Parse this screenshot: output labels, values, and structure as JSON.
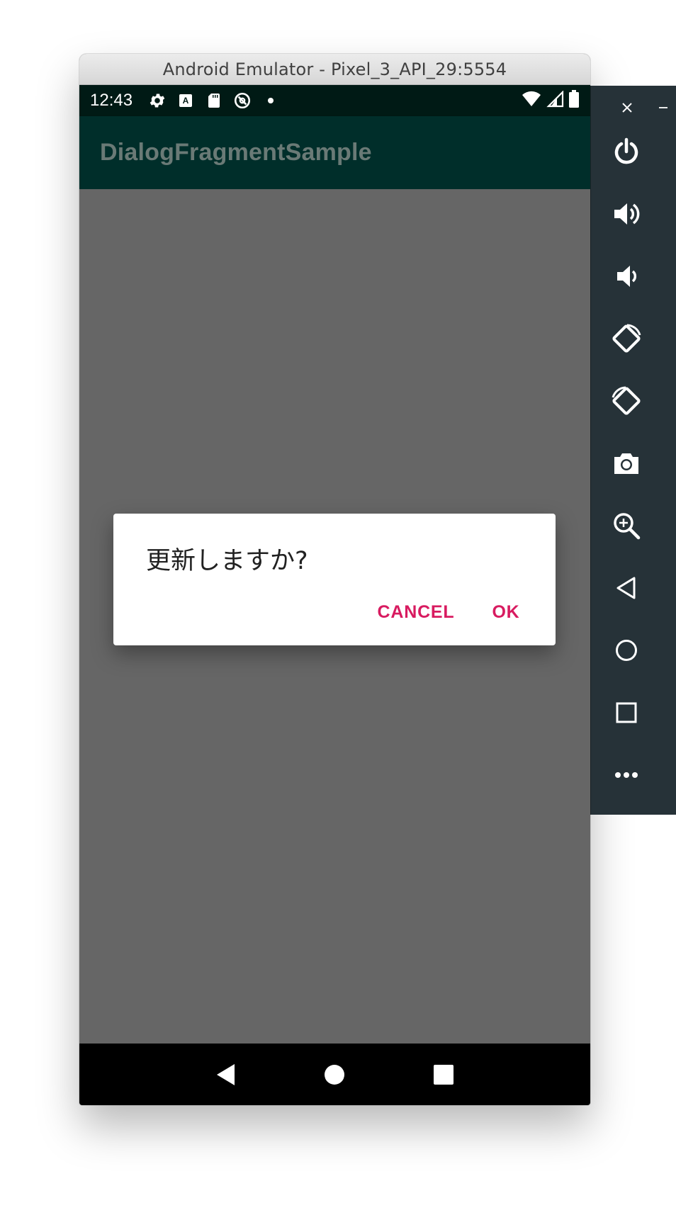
{
  "window": {
    "title": "Android Emulator - Pixel_3_API_29:5554"
  },
  "status_bar": {
    "time": "12:43",
    "icons_left": [
      "gear-icon",
      "keyboard-a-icon",
      "sd-card-icon",
      "at-sign-icon",
      "dot-icon"
    ],
    "icons_right": [
      "wifi-icon",
      "signal-icon",
      "battery-icon"
    ]
  },
  "app_bar": {
    "title": "DialogFragmentSample"
  },
  "dialog": {
    "message": "更新しますか?",
    "cancel_label": "CANCEL",
    "ok_label": "OK"
  },
  "nav_bar": {
    "buttons": [
      "back-icon",
      "home-icon",
      "recents-icon"
    ]
  },
  "toolbar": {
    "controls": [
      "close",
      "minimize"
    ],
    "buttons": [
      "power-icon",
      "volume-up-icon",
      "volume-down-icon",
      "rotate-left-icon",
      "rotate-right-icon",
      "camera-icon",
      "zoom-icon",
      "back-icon",
      "home-icon",
      "overview-icon",
      "more-icon"
    ]
  },
  "colors": {
    "status_bar": "#001a15",
    "app_bar": "#002e2a",
    "scrim": "#666666",
    "dialog_button": "#d81b60",
    "toolbar": "#263238"
  }
}
